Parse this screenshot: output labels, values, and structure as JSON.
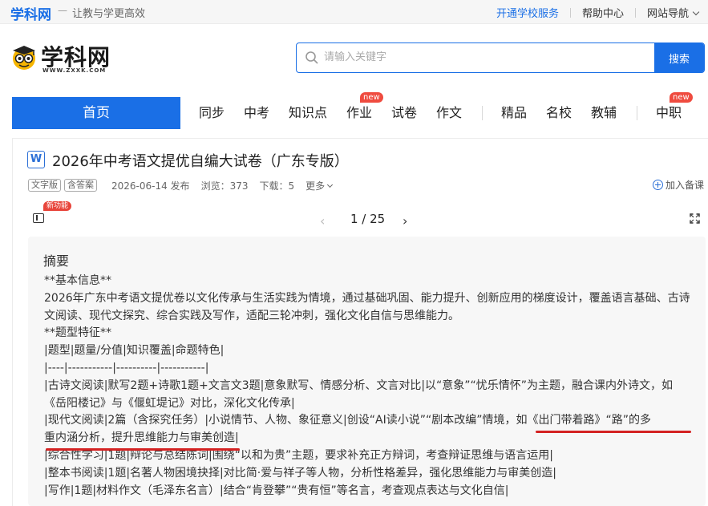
{
  "topbar": {
    "brand": "学科网",
    "separator": "—",
    "slogan": "让教与学更高效",
    "links": [
      "开通学校服务",
      "帮助中心",
      "网站导航"
    ]
  },
  "logo": {
    "text": "学科网",
    "url": "WWW.ZXXK.COM"
  },
  "search": {
    "placeholder": "请输入关键字",
    "value": "",
    "button": "搜索"
  },
  "nav": {
    "home": "首页",
    "items": [
      "同步",
      "中考",
      "知识点",
      "作业",
      "试卷",
      "作文",
      "精品",
      "名校",
      "教辅",
      "中职"
    ],
    "badge": "new"
  },
  "doc": {
    "icon_letter": "W",
    "title": "2026年中考语文提优自编大试卷（广东专版）",
    "tags": [
      "文字版",
      "含答案"
    ],
    "date": "2026-06-14 发布",
    "views": "浏览：373",
    "downloads": "下载：5",
    "more": "更多",
    "favorite": "加入备课"
  },
  "viewer": {
    "new_feature_badge": "新功能",
    "page_indicator": "1 / 25",
    "prev": "‹",
    "next": "›"
  },
  "abstract": {
    "title": "摘要",
    "lines": [
      "**基本信息**",
      "2026年广东中考语文提优卷以文化传承与生活实践为情境，通过基础巩固、能力提升、创新应用的梯度设计，覆盖语言基础、古诗",
      "文阅读、现代文探究、综合实践及写作，适配三轮冲刺，强化文化自信与思维能力。",
      "**题型特征**",
      "|题型|题量/分值|知识覆盖|命题特色|",
      "|----|-----------|----------|-----------|",
      "|古诗文阅读|默写2题+诗歌1题+文言文3题|意象默写、情感分析、文言对比|以“意象”“忧乐情怀”为主题，融合课内外诗文，如",
      "《岳阳楼记》与《偃虹堤记》对比，深化文化传承|",
      "|现代文阅读|2篇（含探究任务）|小说情节、人物、象征意义|创设“AI读小说”“剧本改编”情境，如《出门带着路》“路”的多",
      "重内涵分析，提升思维能力与审美创造|",
      "|综合性学习|1题|辩论与总结陈词|围绕“以和为贵”主题，要求补充正方辩词，考查辩证思维与语言运用|",
      "|整本书阅读|1题|名著人物困境抉择|对比简·爱与祥子等人物，分析性格差异，强化思维能力与审美创造|",
      "|写作|1题|材料作文（毛泽东名言）|结合“肯登攀”“贵有恒”等名言，考查观点表达与文化自信|"
    ]
  },
  "colors": {
    "accent": "#1a6fe6",
    "badge_red": "#ef4b3f",
    "underline_red": "#d42222"
  }
}
